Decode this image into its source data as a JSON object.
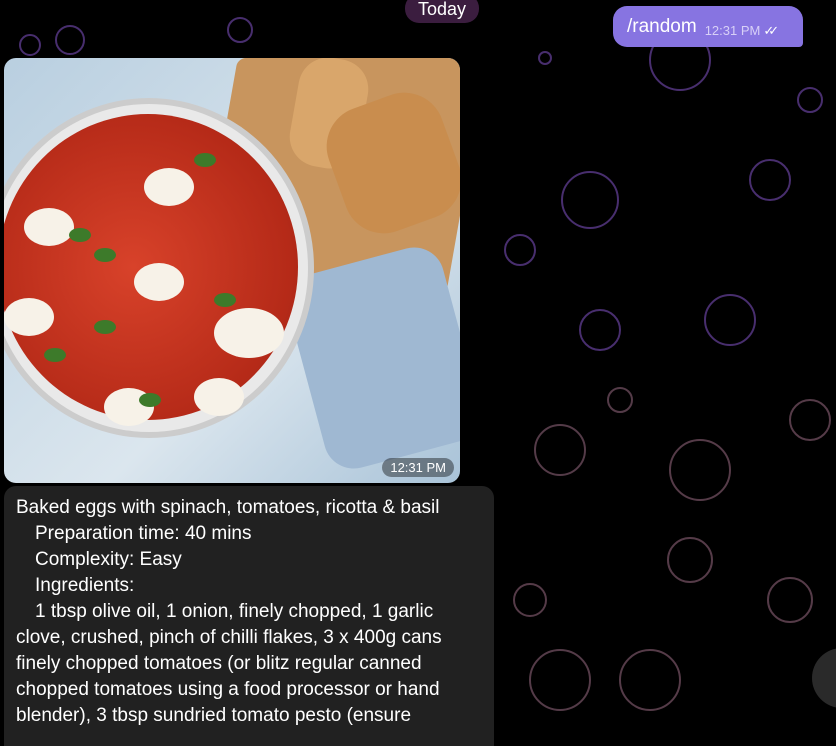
{
  "chat": {
    "date_separator": "Today",
    "outgoing": {
      "text": "/random",
      "time": "12:31 PM",
      "status_icon": "double-check-icon"
    },
    "incoming": {
      "photo_alt": "baked eggs photo",
      "photo_time": "12:31 PM",
      "lines": [
        "Baked eggs with spinach, tomatoes, ricotta & basil",
        "Preparation time: 40 mins",
        "Complexity: Easy",
        "Ingredients:",
        "1 tbsp olive oil, 1 onion, finely chopped, 1 garlic clove, crushed, pinch of chilli flakes, 3 x 400g cans finely chopped tomatoes (or blitz regular canned chopped tomatoes using a food processor or hand blender), 3 tbsp  sundried tomato pesto (ensure"
      ]
    }
  },
  "colors": {
    "outgoing_bubble": "#8774e1",
    "incoming_bubble": "#212121",
    "background": "#000000"
  }
}
